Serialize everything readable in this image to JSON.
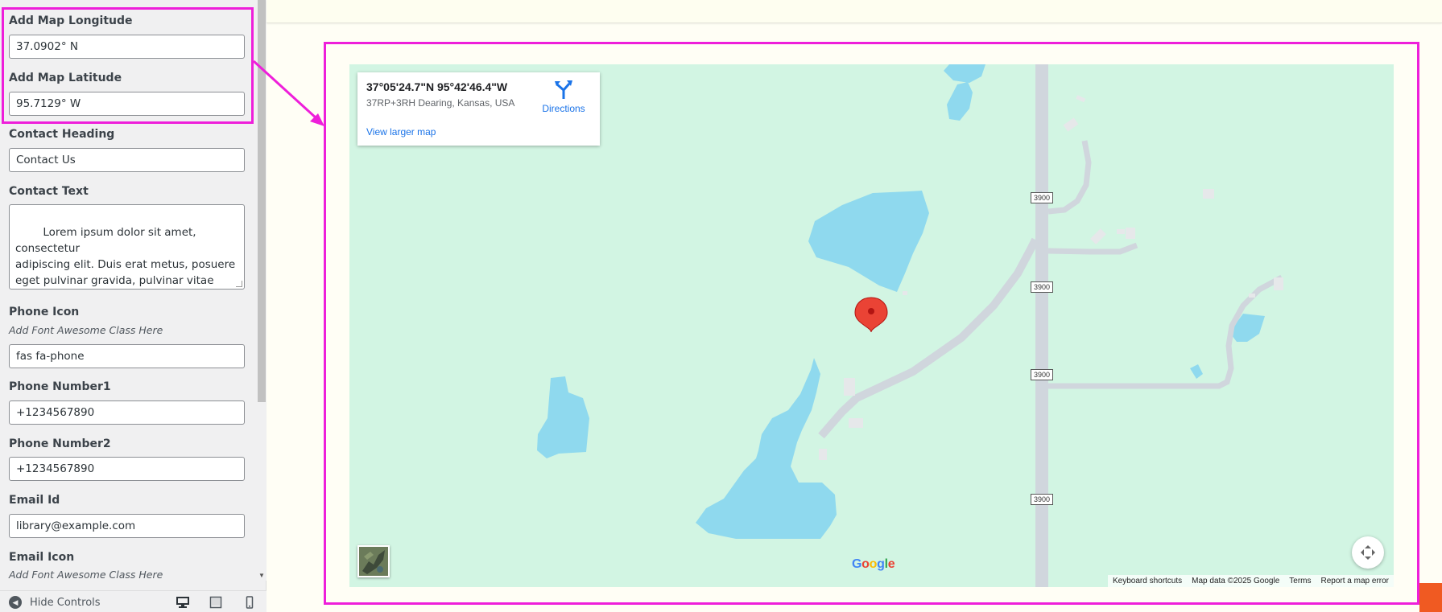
{
  "sidebar": {
    "fields": {
      "map_longitude": {
        "label": "Add Map Longitude",
        "value": "37.0902° N"
      },
      "map_latitude": {
        "label": "Add Map Latitude",
        "value": "95.7129° W"
      },
      "contact_heading": {
        "label": "Contact Heading",
        "value": "Contact Us"
      },
      "contact_text": {
        "label": "Contact Text",
        "value": "Lorem ipsum dolor sit amet, consectetur\nadipiscing elit. Duis erat metus, posuere\neget pulvinar gravida, pulvinar vitae velit.\nQuisque vel"
      },
      "phone_icon": {
        "label": "Phone Icon",
        "description": "Add Font Awesome Class Here",
        "value": "fas fa-phone"
      },
      "phone_number1": {
        "label": "Phone Number1",
        "value": "+1234567890"
      },
      "phone_number2": {
        "label": "Phone Number2",
        "value": "+1234567890"
      },
      "email_id": {
        "label": "Email Id",
        "value": "library@example.com"
      },
      "email_icon": {
        "label": "Email Icon",
        "description": "Add Font Awesome Class Here"
      }
    },
    "footer": {
      "hide_controls_label": "Hide Controls",
      "devices": [
        "desktop-icon",
        "tablet-icon",
        "mobile-icon"
      ]
    }
  },
  "map": {
    "info_card": {
      "coordinates": "37°05'24.7\"N 95°42'46.4\"W",
      "address": "37RP+3RH Dearing, Kansas, USA",
      "directions_label": "Directions",
      "larger_map_label": "View larger map"
    },
    "road_shields": [
      "3900",
      "3900",
      "3900",
      "3900"
    ],
    "google_logo": "Google",
    "attribution": {
      "keyboard_shortcuts": "Keyboard shortcuts",
      "map_data": "Map data ©2025 Google",
      "terms": "Terms",
      "report": "Report a map error"
    }
  },
  "colors": {
    "highlight": "#ee1fda",
    "map_land": "#d2f5e3",
    "map_water": "#8fd9ee",
    "link_blue": "#1a73e8",
    "marker_red": "#ea4335"
  }
}
